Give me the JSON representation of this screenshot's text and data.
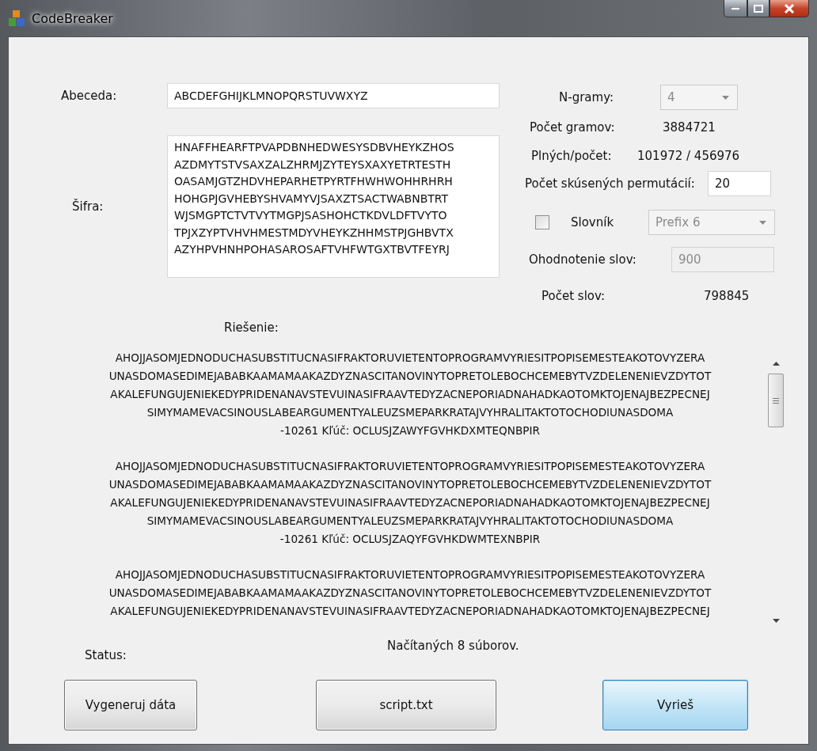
{
  "window": {
    "title": "CodeBreaker"
  },
  "alphabet": {
    "label": "Abeceda:",
    "value": "ABCDEFGHIJKLMNOPQRSTUVWXYZ"
  },
  "cipher": {
    "label": "Šifra:",
    "lines": [
      "HNAFFHEARFTPVAPDBNHEDWESYSDBVHEYKZHOS",
      "AZDMYTSTVSAXZALZHRMJZYTEYSXAXYETRTESTH",
      "OASAMJGTZHDVHEPARHETPYRTFHWHWOHHRHRH",
      "HOHGPJGVHEBYSHVAMYVJSAXZTSACTWABNBTRT",
      "WJSMGPTCTVTVYTMGPJSASHOHCTKDVLDFTVYTO",
      "TPJXZYPTVHVHMESTMDYVHEYKZHHMSTPJGHBVTX",
      "AZYHPVHNHPOHASAROSAFTVHFWTGXTBVTFEYRJ"
    ]
  },
  "ngrams": {
    "label": "N-gramy:",
    "value": "4",
    "disabled": true
  },
  "stats": [
    {
      "label": "Počet gramov:",
      "value": "3884721"
    },
    {
      "label": "Plných/počet:",
      "value": "101972 / 456976"
    }
  ],
  "permutations": {
    "label": "Počet skúsených permutácií:",
    "value": "20"
  },
  "dictionary": {
    "label": "Slovník",
    "checked": false,
    "value": "Prefix 6",
    "disabled": true
  },
  "word_score": {
    "label": "Ohodnotenie slov:",
    "value": "900",
    "disabled": true
  },
  "word_count": {
    "label": "Počet slov:",
    "value": "798845"
  },
  "solution": {
    "label": "Riešenie:",
    "results": [
      {
        "lines": [
          "AHOJJASOMJEDNODUCHASUBSTITUCNASIFRAKTORUVIETENTOPROGRAMVYRIESITPOPISEMESTEAKOTOVYZERA",
          "UNASDOMASEDIMEJABABKAAMAMAAKAZDYZNASCITANOVINYTOPRETOLEBOCHCEMEBYTVZDELENENIEVZDYTOT",
          "AKALEFUNGUJENIEKEDYPRIDENANAVSTEVUINASIFRAAVTEDYZACNEPORIADNAHADKAOTOMKTOJENAJBEZPECNEJ",
          "SIMYMAMEVACSINOUSLABEARGUMENTYALEUZSMEPARKRATAJVYHRALITAKTOTOCHODIUNASDOMA",
          "-10261 Kľúč: OCLUSJZAWYFGVHKDXMTEQNBPIR"
        ]
      },
      {
        "lines": [
          "AHOJJASOMJEDNODUCHASUBSTITUCNASIFRAKTORUVIETENTOPROGRAMVYRIESITPOPISEMESTEAKOTOVYZERA",
          "UNASDOMASEDIMEJABABKAAMAMAAKAZDYZNASCITANOVINYTOPRETOLEBOCHCEMEBYTVZDELENENIEVZDYTOT",
          "AKALEFUNGUJENIEKEDYPRIDENANAVSTEVUINASIFRAAVTEDYZACNEPORIADNAHADKAOTOMKTOJENAJBEZPECNEJ",
          "SIMYMAMEVACSINOUSLABEARGUMENTYALEUZSMEPARKRATAJVYHRALITAKTOTOCHODIUNASDOMA",
          "-10261 Kľúč: OCLUSJZAQYFGVHKDWMTEXNBPIR"
        ]
      },
      {
        "lines": [
          "AHOJJASOMJEDNODUCHASUBSTITUCNASIFRAKTORUVIETENTOPROGRAMVYRIESITPOPISEMESTEAKOTOVYZERA",
          "UNASDOMASEDIMEJABABKAAMAMAAKAZDYZNASCITANOVINYTOPRETOLEBOCHCEMEBYTVZDELENENIEVZDYTOT",
          "AKALEFUNGUJENIEKEDYPRIDENANAVSTEVUINASIFRAAVTEDYZACNEPORIADNAHADKAOTOMKTOJENAJBEZPECNEJ"
        ]
      }
    ]
  },
  "status": {
    "label": "Status:",
    "text": "Načítaných 8 súborov."
  },
  "buttons": [
    {
      "label": "Vygeneruj dáta",
      "focused": false
    },
    {
      "label": "script.txt",
      "focused": false
    },
    {
      "label": "Vyrieš",
      "focused": true
    }
  ]
}
